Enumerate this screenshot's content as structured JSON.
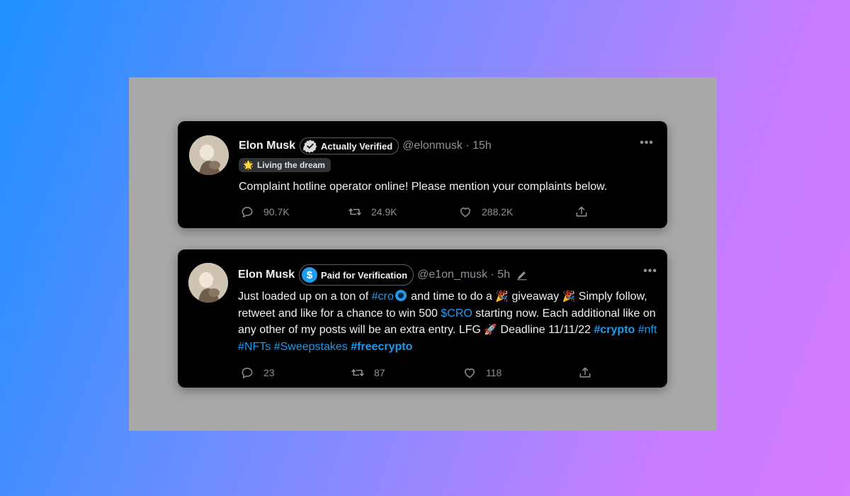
{
  "tweets": [
    {
      "name": "Elon Musk",
      "badge": "Actually Verified",
      "handle": "@elonmusk",
      "time": "15h",
      "status": "Living the dream",
      "text": "Complaint hotline operator online! Please mention your complaints below.",
      "replies": "90.7K",
      "retweets": "24.9K",
      "likes": "288.2K"
    },
    {
      "name": "Elon Musk",
      "badge": "Paid for Verification",
      "handle": "@e1on_musk",
      "time": "5h",
      "text_parts": {
        "p1": "Just loaded up on a ton of ",
        "h_cro": "#cro",
        "p2": " and time to do a ",
        "p3": " giveaway ",
        "p4": " Simply follow, retweet and like for a chance to win 500 ",
        "cashtag": "$CRO",
        "p5": " starting now. Each additional like on any other of my posts will be an extra entry. LFG ",
        "p6": " Deadline 11/11/22 ",
        "h_crypto": "#crypto",
        "h_nft": "#nft",
        "h_nfts": "#NFTs",
        "h_sweep": "#Sweepstakes",
        "h_free": "#freecrypto"
      },
      "replies": "23",
      "retweets": "87",
      "likes": "118"
    }
  ],
  "icons": [
    "verified-badge-icon",
    "dollar-badge-icon",
    "sparkle-icon",
    "more-icon",
    "reply-icon",
    "retweet-icon",
    "like-icon",
    "share-icon",
    "pencil-icon",
    "cro-coin-icon",
    "party-popper-icon",
    "rocket-icon"
  ],
  "colors": {
    "link": "#1d9bf0",
    "tweet_bg": "#000000",
    "panel_bg": "#a8a8a8"
  }
}
